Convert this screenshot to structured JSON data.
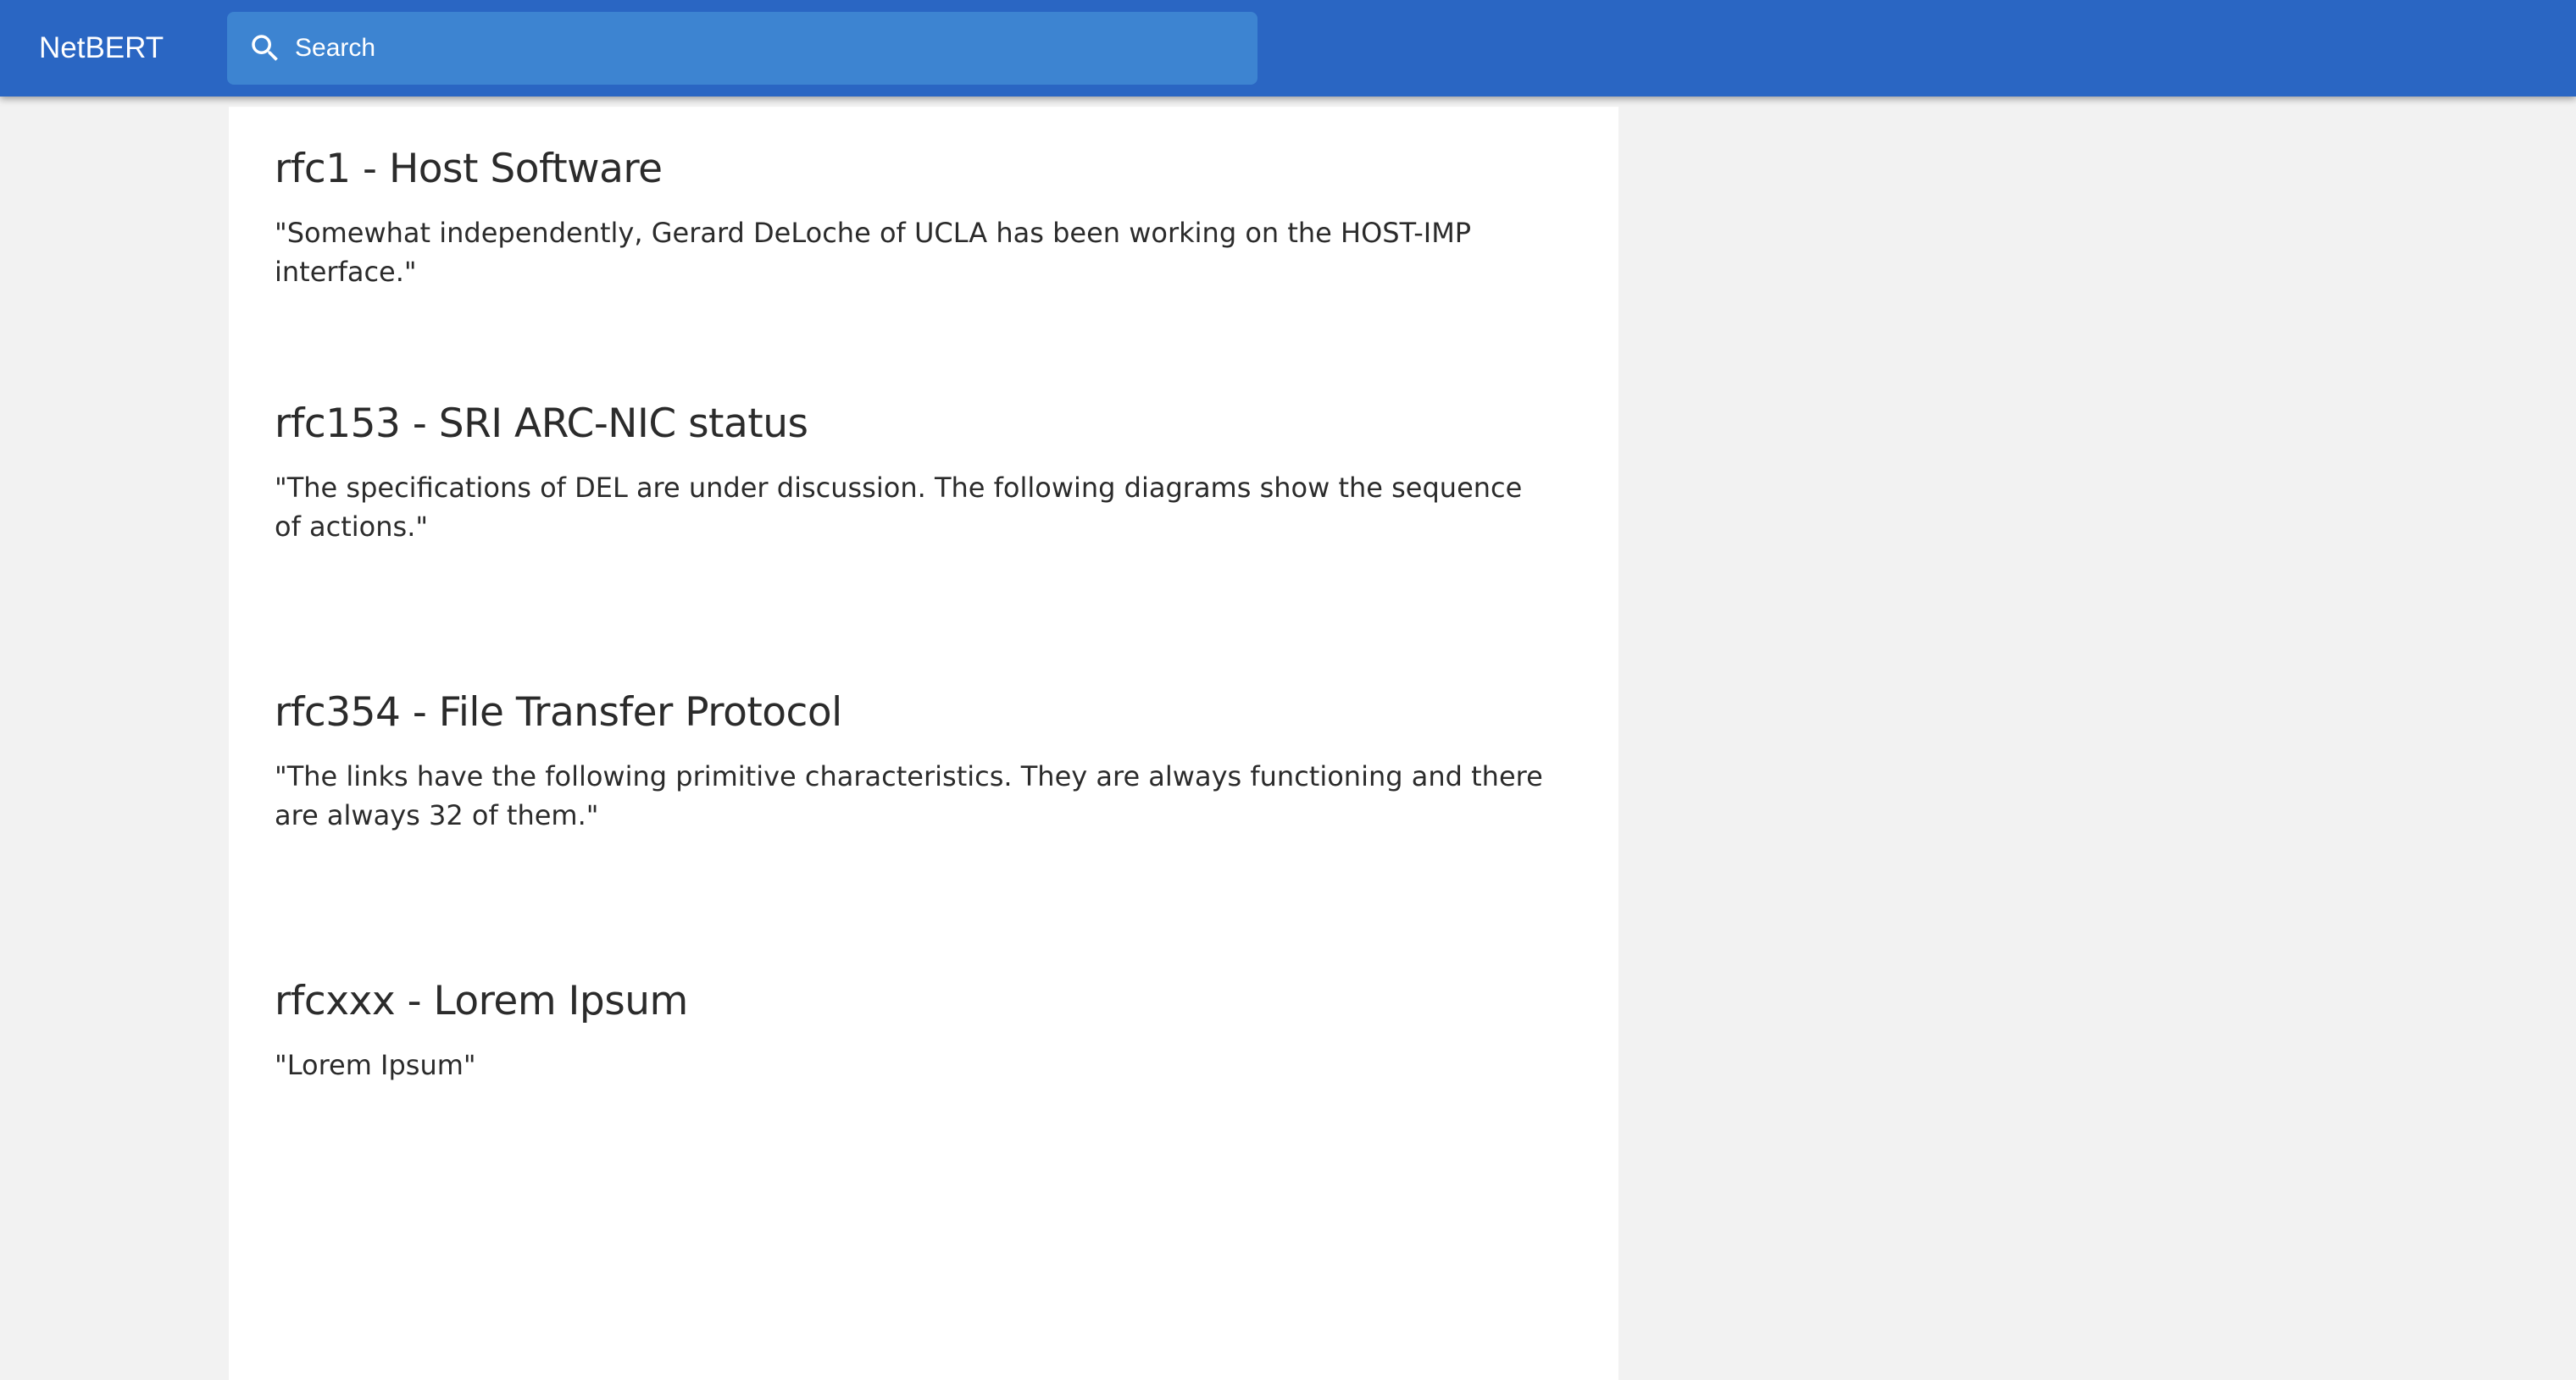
{
  "header": {
    "app_title": "NetBERT",
    "search_placeholder": "Search",
    "search_icon": "search-icon",
    "bar_color": "#2a66c3",
    "search_bg_color": "#3d84d1"
  },
  "results": [
    {
      "title": "rfc1 - Host Software",
      "snippet": "\"Somewhat independently, Gerard DeLoche of UCLA has been working on the HOST-IMP interface.\""
    },
    {
      "title": "rfc153 - SRI ARC-NIC status",
      "snippet": "\"The specifications of DEL are under discussion. The following diagrams show the sequence of actions.\""
    },
    {
      "title": "rfc354 - File Transfer Protocol",
      "snippet": "\"The links have the following primitive characteristics. They are always functioning and there are always 32 of them.\""
    },
    {
      "title": "rfcxxx - Lorem Ipsum",
      "snippet": "\"Lorem Ipsum\""
    }
  ]
}
